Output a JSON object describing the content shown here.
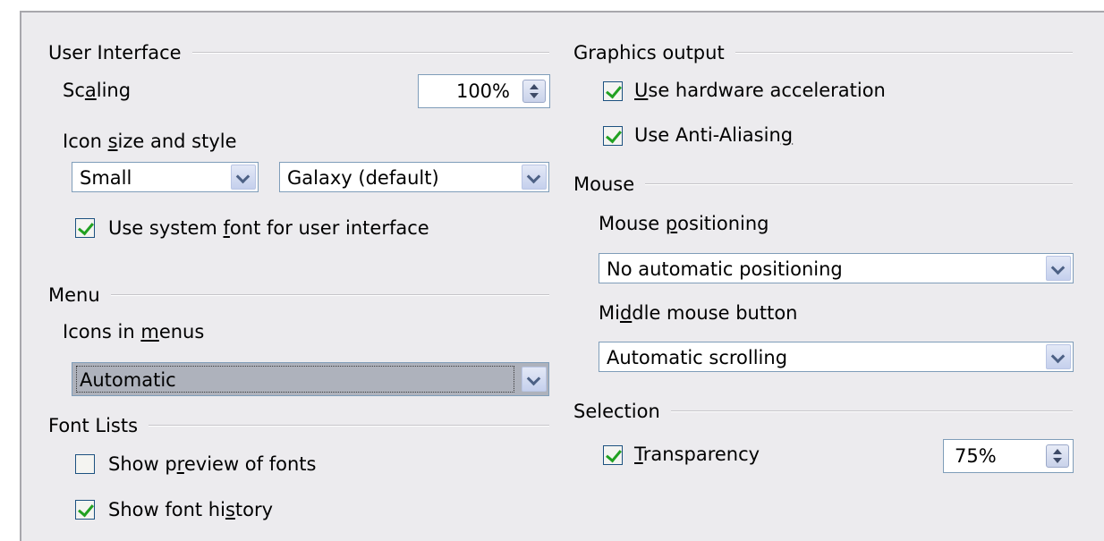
{
  "user_interface": {
    "heading": "User Interface",
    "scaling_label_pre": "Sc",
    "scaling_label_key": "a",
    "scaling_label_post": "ling",
    "scaling_value": "100%",
    "icon_label_pre": "Icon ",
    "icon_label_key": "s",
    "icon_label_post": "ize and style",
    "icon_size_value": "Small",
    "icon_style_value": "Galaxy (default)",
    "system_font_pre": "Use system ",
    "system_font_key": "f",
    "system_font_post": "ont for user interface",
    "system_font_checked": true
  },
  "menu": {
    "heading": "Menu",
    "icons_label_pre": "Icons in ",
    "icons_label_key": "m",
    "icons_label_post": "enus",
    "icons_value": "Automatic"
  },
  "font_lists": {
    "heading": "Font Lists",
    "preview_pre": "Show p",
    "preview_key": "r",
    "preview_post": "eview of fonts",
    "preview_checked": false,
    "history_pre": "Show font hi",
    "history_key": "s",
    "history_post": "tory",
    "history_checked": true
  },
  "graphics": {
    "heading": "Graphics output",
    "hw_key": "U",
    "hw_post": "se hardware acceleration",
    "hw_checked": true,
    "aa_pre": "Use Anti-Aliasin",
    "aa_key": "g",
    "aa_checked": true
  },
  "mouse": {
    "heading": "Mouse",
    "positioning_label_pre": "Mouse ",
    "positioning_label_key": "p",
    "positioning_label_post": "ositioning",
    "positioning_value": "No automatic positioning",
    "middle_label_pre": "Mi",
    "middle_label_key": "d",
    "middle_label_post": "dle mouse button",
    "middle_value": "Automatic scrolling"
  },
  "selection": {
    "heading": "Selection",
    "transparency_key": "T",
    "transparency_post": "ransparency",
    "transparency_checked": true,
    "transparency_value": "75%"
  },
  "colors": {
    "panel_bg": "#ecebee",
    "check_green": "#21a121",
    "field_border": "#7f9db9"
  }
}
